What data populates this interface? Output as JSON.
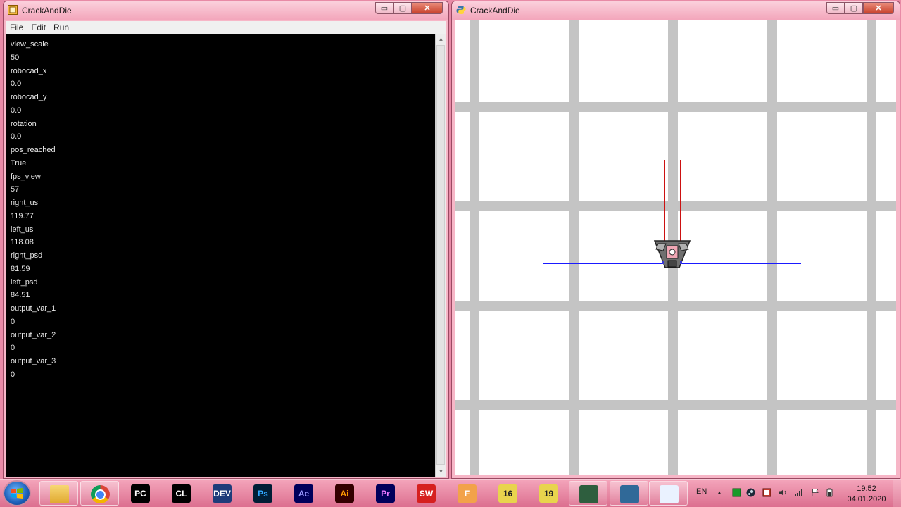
{
  "left_window": {
    "title": "CrackAndDie",
    "controls": {
      "minimize": "▭",
      "maximize": "▢",
      "close": "✕"
    },
    "menu": [
      "File",
      "Edit",
      "Run"
    ],
    "variables": [
      {
        "name": "view_scale",
        "value": "50"
      },
      {
        "name": "robocad_x",
        "value": "0.0"
      },
      {
        "name": "robocad_y",
        "value": "0.0"
      },
      {
        "name": "rotation",
        "value": "0.0"
      },
      {
        "name": "pos_reached",
        "value": "True"
      },
      {
        "name": "fps_view",
        "value": "57"
      },
      {
        "name": "right_us",
        "value": "119.77"
      },
      {
        "name": "left_us",
        "value": "118.08"
      },
      {
        "name": "right_psd",
        "value": "81.59"
      },
      {
        "name": "left_psd",
        "value": "84.51"
      },
      {
        "name": "output_var_1",
        "value": "0"
      },
      {
        "name": "output_var_2",
        "value": "0"
      },
      {
        "name": "output_var_3",
        "value": "0"
      }
    ]
  },
  "right_window": {
    "title": "CrackAndDie",
    "controls": {
      "minimize": "▭",
      "maximize": "▢",
      "close": "✕"
    },
    "scene": {
      "grid_color": "#c4c4c4",
      "background": "#ffffff",
      "ultrasonic_ray_color": "#cc1111",
      "psd_ray_color": "#1a1aff",
      "robot_icon": "robot-icon"
    }
  },
  "taskbar": {
    "start_icon": "windows-start-icon",
    "apps": [
      {
        "name": "file-explorer",
        "label": "",
        "bg": "#f2c94c",
        "fg": "#6b4e00"
      },
      {
        "name": "chrome",
        "label": "",
        "bg": "#ffffff",
        "fg": "#333"
      },
      {
        "name": "pycharm",
        "label": "PC",
        "bg": "#000000",
        "fg": "#ffffff"
      },
      {
        "name": "clion",
        "label": "CL",
        "bg": "#000000",
        "fg": "#ffffff"
      },
      {
        "name": "dev-cpp",
        "label": "DEV",
        "bg": "#1e3c7a",
        "fg": "#ffffff"
      },
      {
        "name": "photoshop",
        "label": "Ps",
        "bg": "#001e36",
        "fg": "#31a8ff"
      },
      {
        "name": "after-effects",
        "label": "Ae",
        "bg": "#00005b",
        "fg": "#9999ff"
      },
      {
        "name": "illustrator",
        "label": "Ai",
        "bg": "#330000",
        "fg": "#ff9a00"
      },
      {
        "name": "premiere",
        "label": "Pr",
        "bg": "#00005b",
        "fg": "#ea77ff"
      },
      {
        "name": "solidworks",
        "label": "SW",
        "bg": "#d6201f",
        "fg": "#ffffff"
      },
      {
        "name": "fusion",
        "label": "F",
        "bg": "#f2a24a",
        "fg": "#ffffff"
      },
      {
        "name": "labview-16",
        "label": "16",
        "bg": "#e8d44d",
        "fg": "#222"
      },
      {
        "name": "labview-19",
        "label": "19",
        "bg": "#e8d44d",
        "fg": "#222"
      },
      {
        "name": "terminal",
        "label": "",
        "bg": "#2e5e3e",
        "fg": "#9cf09c"
      },
      {
        "name": "python",
        "label": "",
        "bg": "#306998",
        "fg": "#ffd43b"
      },
      {
        "name": "paint",
        "label": "",
        "bg": "#eaf2ff",
        "fg": "#c03"
      }
    ],
    "language": "EN",
    "tray_arrow": "▲",
    "tray_icons": [
      "green-square-icon",
      "steam-icon",
      "shield-icon",
      "volume-icon",
      "signal-icon",
      "flag-icon",
      "power-icon"
    ],
    "time": "19:52",
    "date": "04.01.2020"
  }
}
